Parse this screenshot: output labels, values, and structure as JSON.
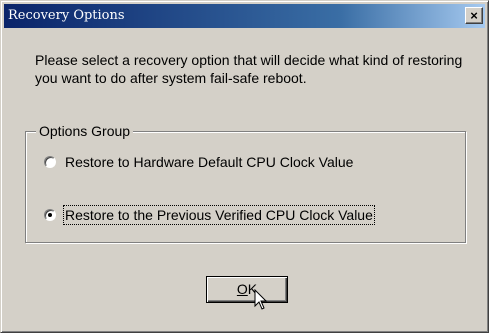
{
  "window": {
    "title": "Recovery Options",
    "close_glyph": "×"
  },
  "message": "Please select a recovery option that will decide what kind of restoring you want to do after system fail-safe reboot.",
  "options_group": {
    "label": "Options Group",
    "options": [
      {
        "label": "Restore to Hardware Default CPU Clock Value",
        "selected": false
      },
      {
        "label": "Restore to the Previous Verified CPU Clock Value",
        "selected": true
      }
    ]
  },
  "ok_button": {
    "mnemonic": "O",
    "rest": "K"
  },
  "icons": {
    "cursor": "arrow-pointer-icon"
  }
}
